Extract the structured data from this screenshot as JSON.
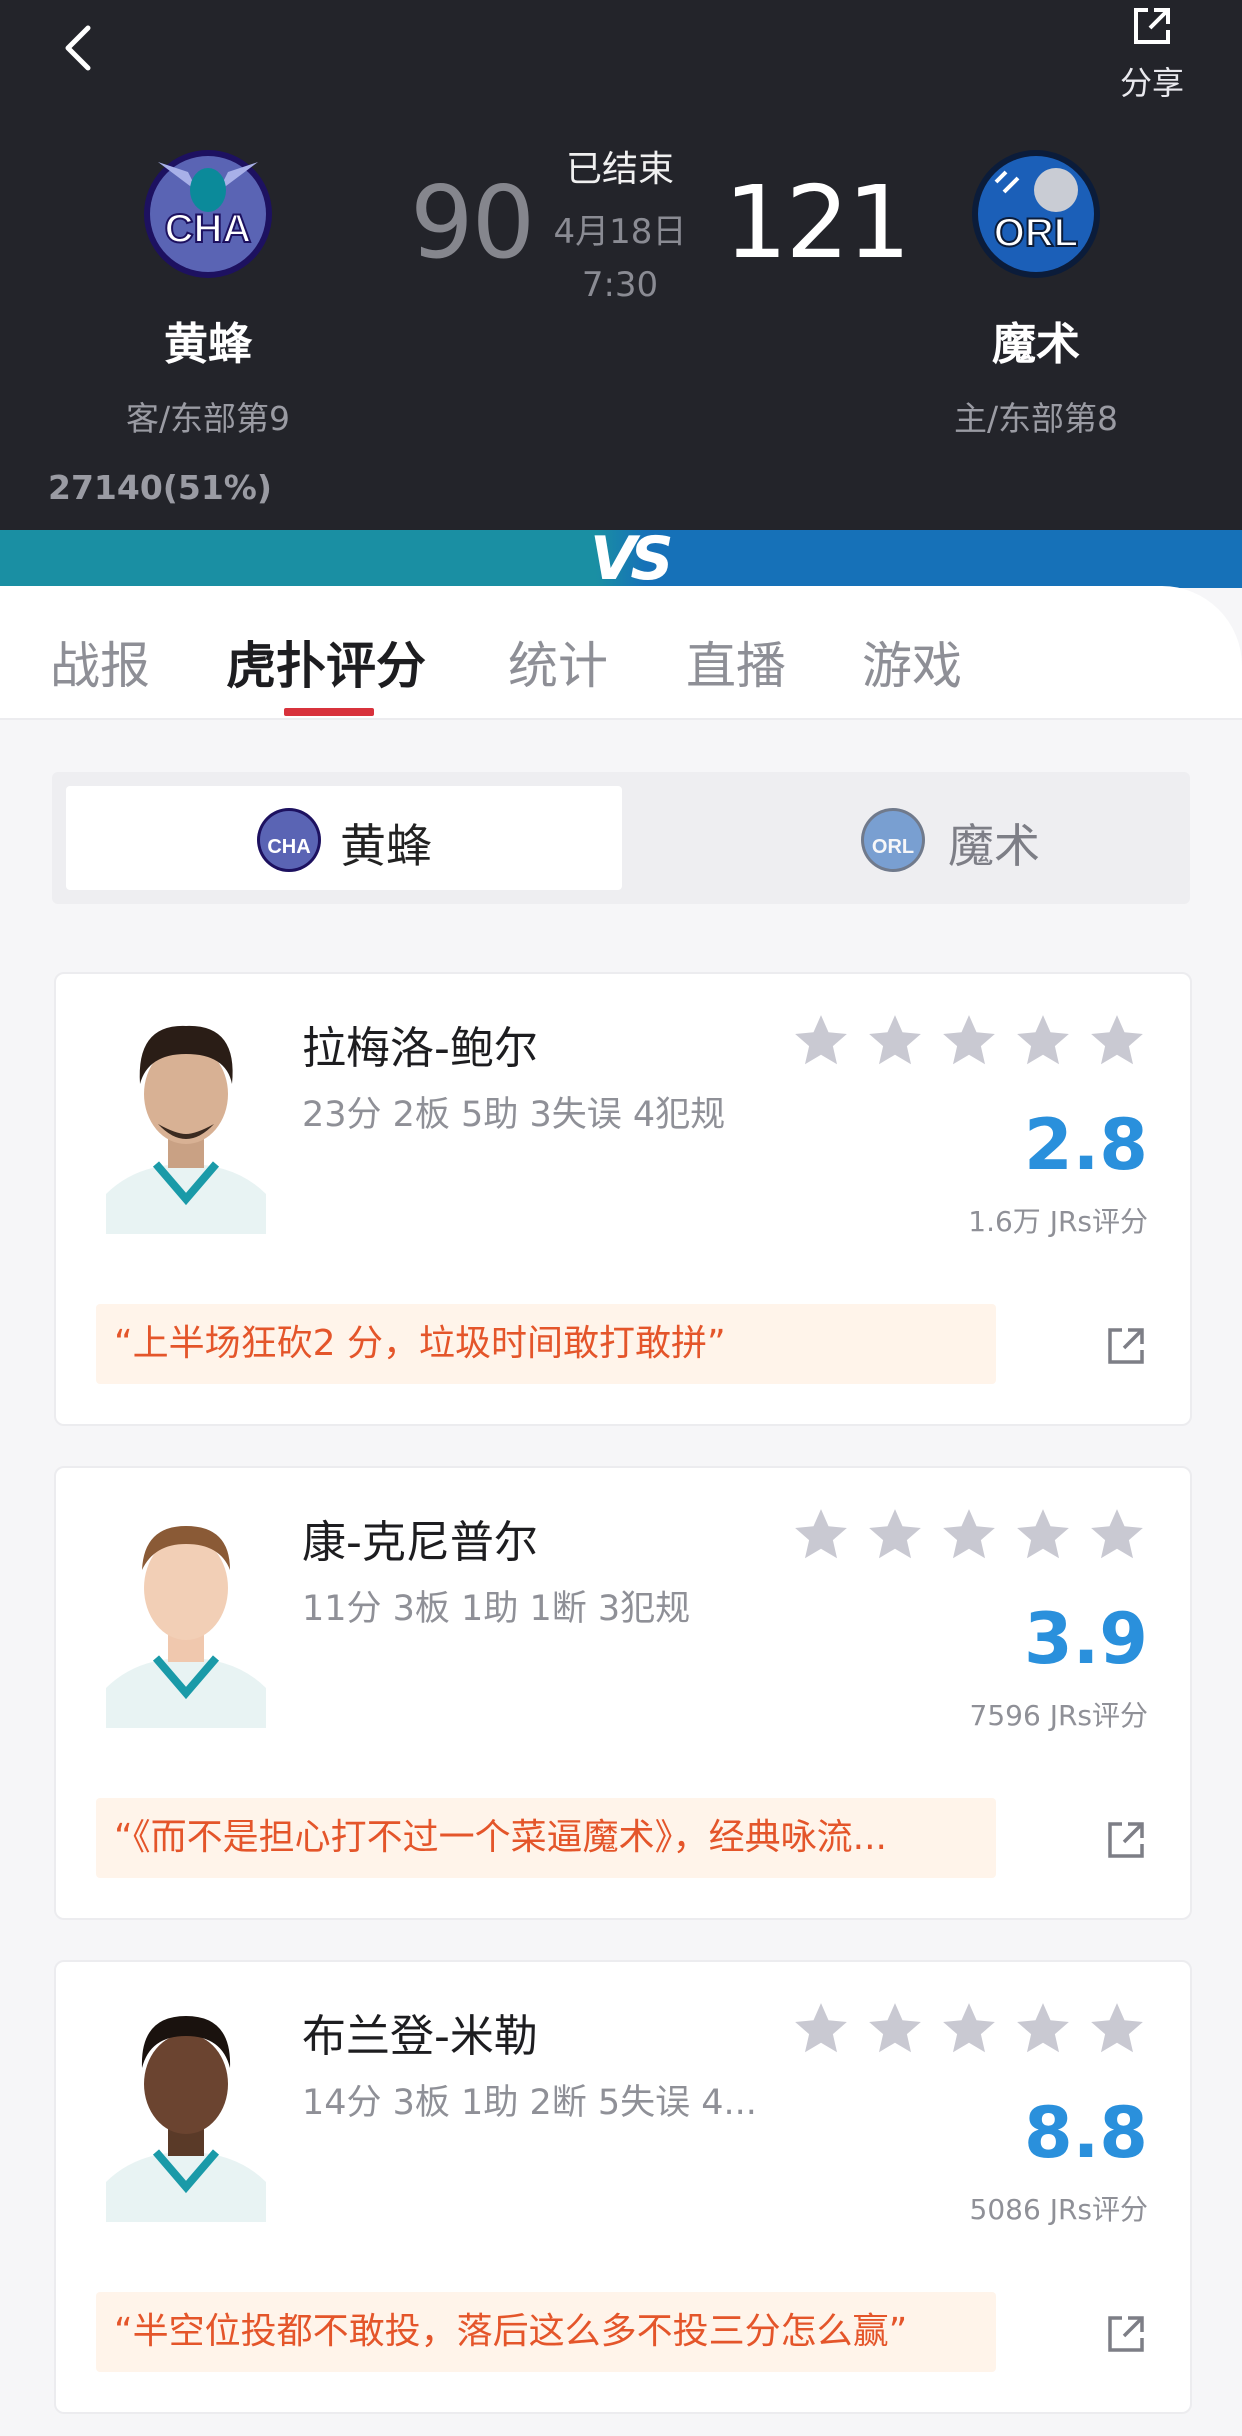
{
  "header": {
    "share_label": "分享",
    "status": "已结束",
    "date": "4月18日",
    "time": "7:30",
    "away": {
      "logo_text": "CHA",
      "name": "黄蜂",
      "sub": "客/东部第9",
      "score": "90",
      "support": "27140(51%)"
    },
    "home": {
      "logo_text": "ORL",
      "name": "魔术",
      "sub": "主/东部第8",
      "score": "121"
    },
    "vs_text": "VS"
  },
  "tabs": [
    "战报",
    "虎扑评分",
    "统计",
    "直播",
    "游戏"
  ],
  "active_tab": "虎扑评分",
  "team_switch": {
    "options": [
      "黄蜂",
      "魔术"
    ],
    "selected": "黄蜂"
  },
  "players": [
    {
      "name": "拉梅洛-鲍尔",
      "stats": "23分 2板 5助 3失误 4犯规",
      "rating": "2.8",
      "rating_count": "1.6万 JRs评分",
      "comment": "“上半场狂砍2 分，垃圾时间敢打敢拼”"
    },
    {
      "name": "康-克尼普尔",
      "stats": "11分 3板 1助 1断 3犯规",
      "rating": "3.9",
      "rating_count": "7596 JRs评分",
      "comment": "“《而不是担心打不过一个菜逼魔术》，经典咏流..."
    },
    {
      "name": "布兰登-米勒",
      "stats": "14分 3板 1助 2断 5失误 4...",
      "rating": "8.8",
      "rating_count": "5086 JRs评分",
      "comment": "“半空位投都不敢投，落后这么多不投三分怎么赢”"
    }
  ],
  "colors": {
    "accent_red": "#d8323c",
    "rating_blue": "#2a90dc",
    "comment_orange": "#e4552a",
    "header_bg": "#23242a"
  }
}
